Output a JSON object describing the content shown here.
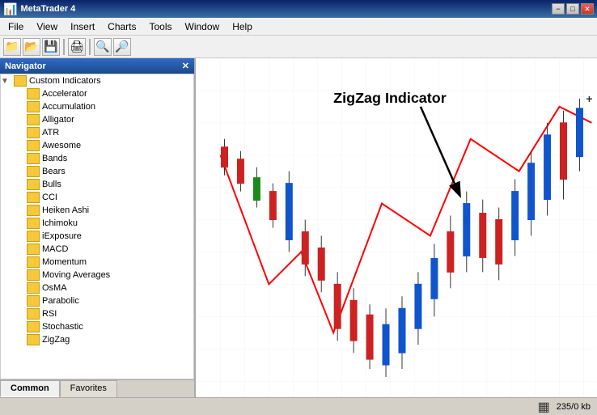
{
  "titlebar": {
    "title": "MetaTrader 4",
    "minimize": "−",
    "restore": "□",
    "close": "✕"
  },
  "menubar": {
    "items": [
      "File",
      "View",
      "Insert",
      "Charts",
      "Tools",
      "Window",
      "Help"
    ]
  },
  "navigator": {
    "title": "Navigator",
    "close": "✕",
    "sections": {
      "custom_indicators": {
        "label": "Custom Indicators",
        "items": [
          "Accelerator",
          "Accumulation",
          "Alligator",
          "ATR",
          "Awesome",
          "Bands",
          "Bears",
          "Bulls",
          "CCI",
          "Heiken Ashi",
          "Ichimoku",
          "iExposure",
          "MACD",
          "Momentum",
          "Moving Averages",
          "OsMA",
          "Parabolic",
          "RSI",
          "Stochastic",
          "ZigZag"
        ]
      }
    },
    "tabs": [
      "Common",
      "Favorites"
    ]
  },
  "chart": {
    "zigzag_label": "ZigZag Indicator"
  },
  "statusbar": {
    "memory": "235/0 kb"
  }
}
